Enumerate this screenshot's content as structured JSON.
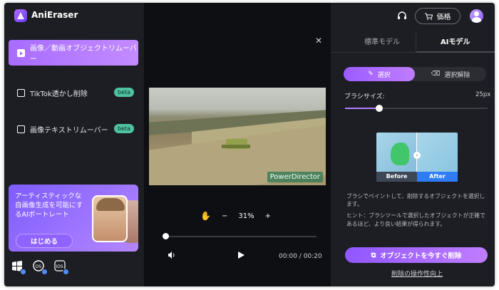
{
  "app": {
    "title": "AniEraser"
  },
  "header": {
    "price_label": "価格"
  },
  "sidebar": {
    "items": [
      {
        "label": "画像／動画オブジェクトリムーバー",
        "active": true
      },
      {
        "label": "TikTok透かし削除",
        "badge": "beta"
      },
      {
        "label": "画像テキストリムーバー",
        "badge": "beta"
      }
    ],
    "promo": {
      "text": "アーティスティックな自画像生成を可能にするAIポートレート",
      "button": "はじめる"
    },
    "os_icons": [
      "windows-icon",
      "mac-icon",
      "ios-icon"
    ]
  },
  "preview": {
    "watermark": "PowerDirector",
    "zoom": "31%",
    "zoom_minus": "−",
    "zoom_plus": "+",
    "time": "00:00 / 00:20",
    "progress": 0
  },
  "right_panel": {
    "tabs": {
      "standard": "標準モデル",
      "ai": "AIモデル"
    },
    "mode": {
      "select": "選択",
      "deselect": "選択解除"
    },
    "brush": {
      "label": "ブラシサイズ:",
      "value": "25px",
      "level": 0.24
    },
    "before_after": {
      "before": "Before",
      "after": "After"
    },
    "hint_paint": "ブラシでペイントして、削除するオブジェクトを選択します。",
    "hint_tip": "ヒント：ブラシツールで選択したオブジェクトが正確であるほど、より良い結果が得られます。",
    "remove_button": "オブジェクトを今すぐ削除",
    "guide_link": "削除の操作性向上"
  },
  "colors": {
    "accent": "#a86cff",
    "background": "#1d1e23",
    "preview_bg": "#0e0f12"
  }
}
